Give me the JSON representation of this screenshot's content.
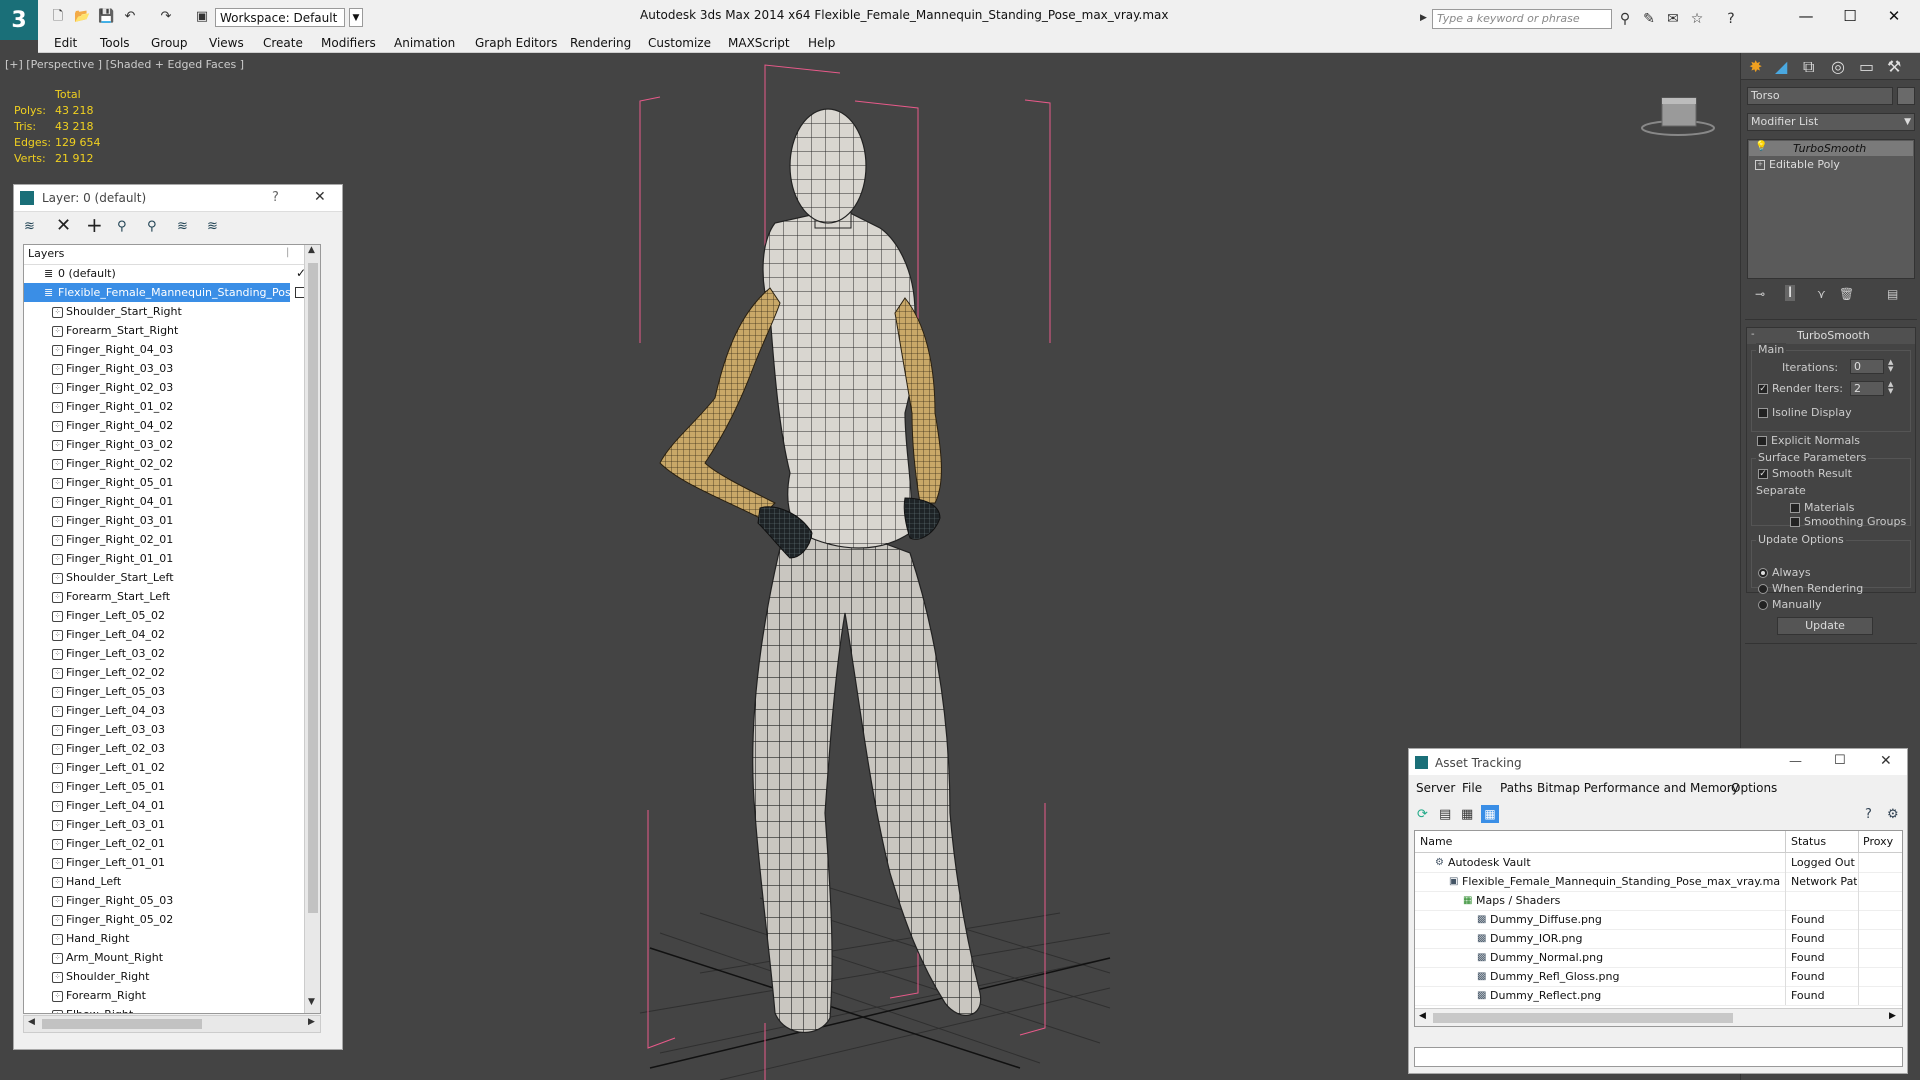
{
  "window": {
    "title": "Autodesk 3ds Max  2014 x64      Flexible_Female_Mannequin_Standing_Pose_max_vray.max",
    "workspace": "Workspace: Default",
    "search_placeholder": "Type a keyword or phrase",
    "minimize": "—",
    "maximize": "☐",
    "close": "✕"
  },
  "menu": [
    "Edit",
    "Tools",
    "Group",
    "Views",
    "Create",
    "Modifiers",
    "Animation",
    "Graph Editors",
    "Rendering",
    "Customize",
    "MAXScript",
    "Help"
  ],
  "viewport": {
    "label": "[+] [Perspective ] [Shaded + Edged Faces ]",
    "stats": {
      "header": "Total",
      "rows": [
        {
          "label": "Polys:",
          "value": "43 218"
        },
        {
          "label": "Tris:",
          "value": "43 218"
        },
        {
          "label": "Edges:",
          "value": "129 654"
        },
        {
          "label": "Verts:",
          "value": "21 912"
        }
      ]
    }
  },
  "layer_dialog": {
    "title": "Layer: 0 (default)",
    "help": "?",
    "close": "✕",
    "column_header": "Layers",
    "layers": [
      {
        "name": "0 (default)",
        "level": 0,
        "checked": true
      },
      {
        "name": "Flexible_Female_Mannequin_Standing_Pose",
        "level": 0,
        "selected": true
      }
    ],
    "objects": [
      "Shoulder_Start_Right",
      "Forearm_Start_Right",
      "Finger_Right_04_03",
      "Finger_Right_03_03",
      "Finger_Right_02_03",
      "Finger_Right_01_02",
      "Finger_Right_04_02",
      "Finger_Right_03_02",
      "Finger_Right_02_02",
      "Finger_Right_05_01",
      "Finger_Right_04_01",
      "Finger_Right_03_01",
      "Finger_Right_02_01",
      "Finger_Right_01_01",
      "Shoulder_Start_Left",
      "Forearm_Start_Left",
      "Finger_Left_05_02",
      "Finger_Left_04_02",
      "Finger_Left_03_02",
      "Finger_Left_02_02",
      "Finger_Left_05_03",
      "Finger_Left_04_03",
      "Finger_Left_03_03",
      "Finger_Left_02_03",
      "Finger_Left_01_02",
      "Finger_Left_05_01",
      "Finger_Left_04_01",
      "Finger_Left_03_01",
      "Finger_Left_02_01",
      "Finger_Left_01_01",
      "Hand_Left",
      "Finger_Right_05_03",
      "Finger_Right_05_02",
      "Hand_Right",
      "Arm_Mount_Right",
      "Shoulder_Right",
      "Forearm_Right",
      "Elbow_Right"
    ]
  },
  "command_panel": {
    "object_name": "Torso",
    "modifier_list": "Modifier List",
    "stack": [
      {
        "name": "TurboSmooth",
        "active": true
      },
      {
        "name": "Editable Poly",
        "active": false
      }
    ],
    "rollout_title": "TurboSmooth",
    "main_group": "Main",
    "iterations_label": "Iterations:",
    "iterations_value": "0",
    "render_iters_label": "Render Iters:",
    "render_iters_value": "2",
    "isoline_label": "Isoline Display",
    "explicit_normals_label": "Explicit Normals",
    "surface_group": "Surface Parameters",
    "smooth_result_label": "Smooth Result",
    "separate_label": "Separate",
    "materials_label": "Materials",
    "smoothing_groups_label": "Smoothing Groups",
    "update_group": "Update Options",
    "always_label": "Always",
    "when_rendering_label": "When Rendering",
    "manually_label": "Manually",
    "update_button": "Update"
  },
  "asset_tracking": {
    "title": "Asset Tracking",
    "minimize": "—",
    "maximize": "☐",
    "close": "✕",
    "menu": [
      "Server",
      "File",
      "Paths",
      "Bitmap Performance and Memory",
      "Options"
    ],
    "columns": [
      "Name",
      "Status",
      "Proxy"
    ],
    "rows": [
      {
        "name": "Autodesk Vault",
        "status": "Logged Out ...",
        "level": 1
      },
      {
        "name": "Flexible_Female_Mannequin_Standing_Pose_max_vray.max",
        "status": "Network Path",
        "level": 2
      },
      {
        "name": "Maps / Shaders",
        "status": "",
        "level": 3
      },
      {
        "name": "Dummy_Diffuse.png",
        "status": "Found",
        "level": 4
      },
      {
        "name": "Dummy_IOR.png",
        "status": "Found",
        "level": 4
      },
      {
        "name": "Dummy_Normal.png",
        "status": "Found",
        "level": 4
      },
      {
        "name": "Dummy_Refl_Gloss.png",
        "status": "Found",
        "level": 4
      },
      {
        "name": "Dummy_Reflect.png",
        "status": "Found",
        "level": 4
      }
    ]
  }
}
